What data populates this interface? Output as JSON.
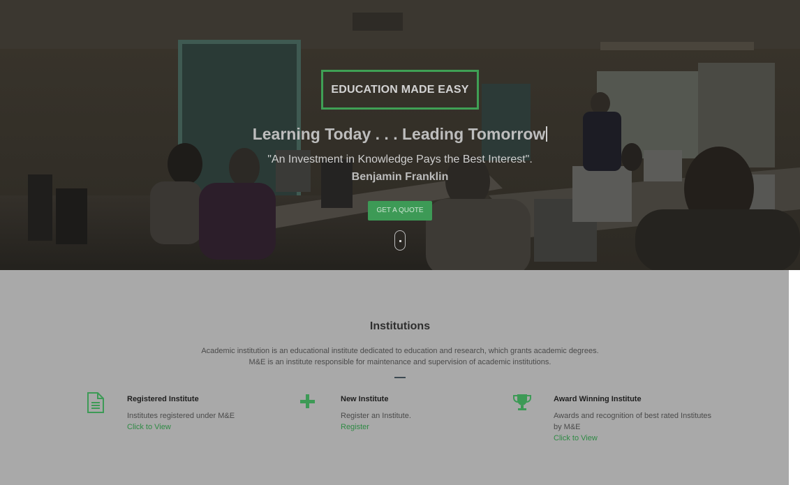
{
  "hero": {
    "tagline": "EDUCATION MADE EASY",
    "headline": "Learning Today . . . Leading Tomorrow",
    "quote": "\"An Investment in Knowledge Pays the Best Interest\".",
    "author": "Benjamin Franklin",
    "cta_label": "GET A QUOTE"
  },
  "institutions": {
    "title": "Institutions",
    "description_line1": "Academic institution is an educational institute dedicated to education and research, which grants academic degrees.",
    "description_line2": "M&E is an institute responsible for maintenance and supervision of academic institutions.",
    "features": [
      {
        "icon": "document-icon",
        "title": "Registered Institute",
        "text": "Institutes registered under M&E",
        "link": "Click to View"
      },
      {
        "icon": "plus-icon",
        "title": "New Institute",
        "text": "Register an Institute.",
        "link": "Register"
      },
      {
        "icon": "trophy-icon",
        "title": "Award Winning Institute",
        "text": "Awards and recognition of best rated Institutes by M&E",
        "link": "Click to View"
      }
    ]
  },
  "colors": {
    "accent": "#3d9a56",
    "overlay_section_bg": "#a9a9a9",
    "hero_text": "#cfcfcf"
  }
}
